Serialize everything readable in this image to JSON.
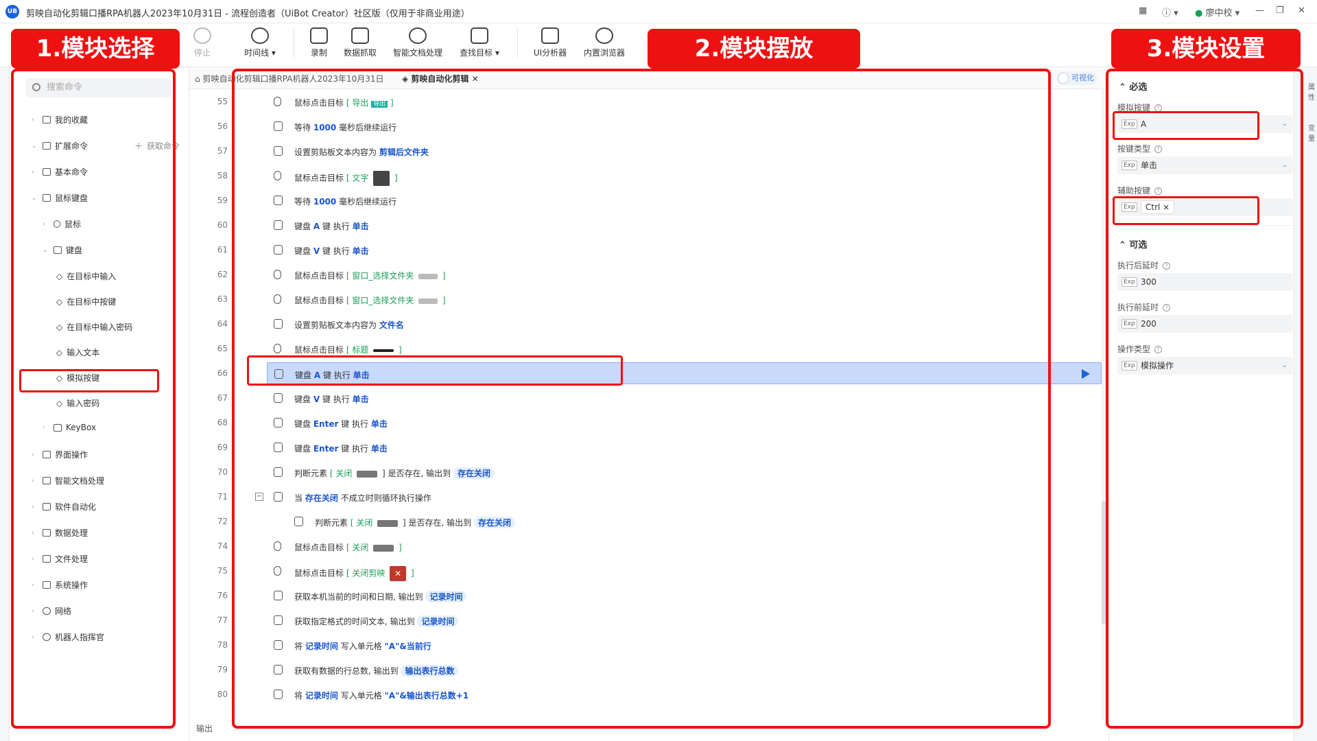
{
  "titlebar": {
    "logo": "UB",
    "title": "剪映自动化剪辑口播RPA机器人2023年10月31日 - 流程创造者（UiBot Creator）社区版（仅用于非商业用途）",
    "user": "廖中校",
    "help_icon": "help-icon",
    "grid_icon": "grid-icon"
  },
  "toolbar": {
    "stop": "停止",
    "timeline": "时间线",
    "record": "录制",
    "data_scrape": "数据抓取",
    "smart_doc": "智能文档处理",
    "find_target": "查找目标",
    "ui_analyzer": "UI分析器",
    "browser": "内置浏览器"
  },
  "annotations": {
    "a1": "1.模块选择",
    "a2": "2.模块摆放",
    "a3": "3.模块设置"
  },
  "left": {
    "search_placeholder": "搜索命令",
    "get_cmd": "获取命令",
    "items": [
      {
        "label": "我的收藏"
      },
      {
        "label": "扩展命令"
      },
      {
        "label": "基本命令"
      },
      {
        "label": "鼠标键盘"
      },
      {
        "label": "鼠标"
      },
      {
        "label": "键盘"
      },
      {
        "label": "在目标中输入"
      },
      {
        "label": "在目标中按键"
      },
      {
        "label": "在目标中输入密码"
      },
      {
        "label": "输入文本"
      },
      {
        "label": "模拟按键"
      },
      {
        "label": "输入密码"
      },
      {
        "label": "KeyBox"
      },
      {
        "label": "界面操作"
      },
      {
        "label": "智能文档处理"
      },
      {
        "label": "软件自动化"
      },
      {
        "label": "数据处理"
      },
      {
        "label": "文件处理"
      },
      {
        "label": "系统操作"
      },
      {
        "label": "网络"
      },
      {
        "label": "机器人指挥官"
      }
    ]
  },
  "tabs": {
    "tab1": "剪映自动化剪辑口播RPA机器人2023年10月31日",
    "tab2": "剪映自动化剪辑",
    "visualize": "可视化"
  },
  "rows": [
    {
      "n": "55",
      "a": "鼠标点击目标",
      "b": "[ 导出",
      "c": "导出",
      "d": "]"
    },
    {
      "n": "56",
      "a": "等待",
      "b": "1000",
      "c": "毫秒后继续运行"
    },
    {
      "n": "57",
      "a": "设置剪贴板文本内容为",
      "b": "剪辑后文件夹"
    },
    {
      "n": "58",
      "a": "鼠标点击目标",
      "b": "[ 文字",
      "d": "]"
    },
    {
      "n": "59",
      "a": "等待",
      "b": "1000",
      "c": "毫秒后继续运行"
    },
    {
      "n": "60",
      "a": "键盘",
      "b": "A",
      "c": "键 执行",
      "d": "单击"
    },
    {
      "n": "61",
      "a": "键盘",
      "b": "V",
      "c": "键 执行",
      "d": "单击"
    },
    {
      "n": "62",
      "a": "鼠标点击目标",
      "b": "[ 窗口_选择文件夹",
      "d": "]"
    },
    {
      "n": "63",
      "a": "鼠标点击目标",
      "b": "[ 窗口_选择文件夹",
      "d": "]"
    },
    {
      "n": "64",
      "a": "设置剪贴板文本内容为",
      "b": "文件名"
    },
    {
      "n": "65",
      "a": "鼠标点击目标",
      "b": "[ 标题",
      "d": "]"
    },
    {
      "n": "66",
      "a": "键盘",
      "b": "A",
      "c": "键 执行",
      "d": "单击"
    },
    {
      "n": "67",
      "a": "键盘",
      "b": "V",
      "c": "键 执行",
      "d": "单击"
    },
    {
      "n": "68",
      "a": "键盘",
      "b": "Enter",
      "c": "键 执行",
      "d": "单击"
    },
    {
      "n": "69",
      "a": "键盘",
      "b": "Enter",
      "c": "键 执行",
      "d": "单击"
    },
    {
      "n": "70",
      "a": "判断元素",
      "b": "[ 关闭",
      "c": "] 是否存在, 输出到",
      "d": "存在关闭"
    },
    {
      "n": "71",
      "a": "当",
      "b": "存在关闭",
      "c": "不成立时则循环执行操作"
    },
    {
      "n": "72",
      "a": "判断元素",
      "b": "[ 关闭",
      "c": "] 是否存在, 输出到",
      "d": "存在关闭"
    },
    {
      "n": "74",
      "a": "鼠标点击目标",
      "b": "[ 关闭",
      "d": "]"
    },
    {
      "n": "75",
      "a": "鼠标点击目标",
      "b": "[ 关闭剪映",
      "d": "]"
    },
    {
      "n": "76",
      "a": "获取本机当前的时间和日期, 输出到",
      "b": "记录时间"
    },
    {
      "n": "77",
      "a": "获取指定格式的时间文本, 输出到",
      "b": "记录时间"
    },
    {
      "n": "78",
      "a": "将",
      "b": "记录时间",
      "c": "写入单元格",
      "d": "\"A\"&当前行"
    },
    {
      "n": "79",
      "a": "获取有数据的行总数, 输出到",
      "b": "输出表行总数"
    },
    {
      "n": "80",
      "a": "将",
      "b": "记录时间",
      "c": "写入单元格",
      "d": "\"A\"&输出表行总数+1"
    }
  ],
  "output_label": "输出",
  "right": {
    "required": "必选",
    "sim_key_label": "模拟按键",
    "sim_key_value": "A",
    "key_type_label": "按键类型",
    "key_type_value": "单击",
    "aux_key_label": "辅助按键",
    "aux_key_value": "Ctrl",
    "optional": "可选",
    "after_delay_label": "执行后延时",
    "after_delay_value": "300",
    "before_delay_label": "执行前延时",
    "before_delay_value": "200",
    "op_type_label": "操作类型",
    "op_type_value": "模拟操作",
    "exp": "Exp",
    "rail1": "属性",
    "rail2": "变量"
  },
  "colors": {
    "accent": "#1a63d8",
    "annotation": "#ee1111",
    "selected_row": "#c9d9fb"
  }
}
